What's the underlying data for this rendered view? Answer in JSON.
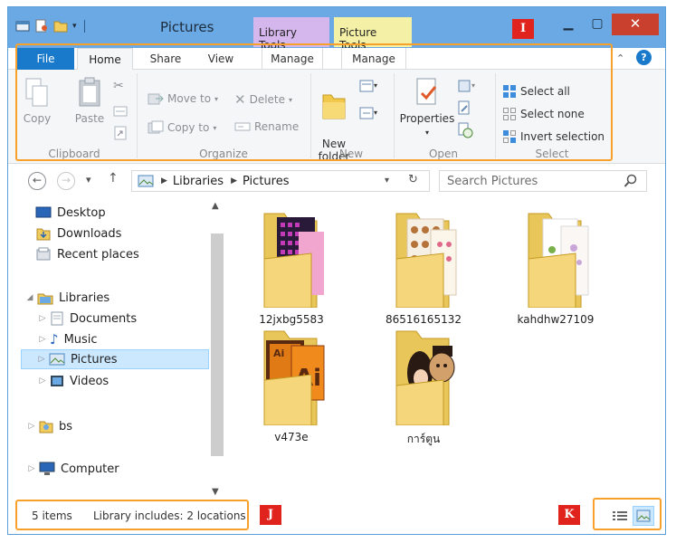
{
  "window": {
    "title": "Pictures"
  },
  "contextual_tabs": {
    "library_tools": "Library Tools",
    "picture_tools": "Picture Tools"
  },
  "ribbon_tabs": {
    "file": "File",
    "home": "Home",
    "share": "Share",
    "view": "View",
    "manage_library": "Manage",
    "manage_picture": "Manage"
  },
  "ribbon": {
    "clipboard": {
      "label": "Clipboard",
      "copy": "Copy",
      "paste": "Paste"
    },
    "organize": {
      "label": "Organize",
      "move_to": "Move to",
      "copy_to": "Copy to",
      "delete": "Delete",
      "rename": "Rename"
    },
    "new": {
      "label": "New",
      "new_folder": "New\nfolder"
    },
    "open": {
      "label": "Open",
      "properties": "Properties"
    },
    "select": {
      "label": "Select",
      "select_all": "Select all",
      "select_none": "Select none",
      "invert_selection": "Invert selection"
    }
  },
  "address": {
    "seg1": "Libraries",
    "seg2": "Pictures"
  },
  "search": {
    "placeholder": "Search Pictures"
  },
  "nav": {
    "desktop": "Desktop",
    "downloads": "Downloads",
    "recent": "Recent places",
    "libraries": "Libraries",
    "documents": "Documents",
    "music": "Music",
    "pictures": "Pictures",
    "videos": "Videos",
    "bs": "bs",
    "computer": "Computer"
  },
  "files": [
    {
      "name": "12jxbg5583"
    },
    {
      "name": "86516165132"
    },
    {
      "name": "kahdhw27109"
    },
    {
      "name": "v473e"
    },
    {
      "name": "การ์ตูน"
    }
  ],
  "status": {
    "items": "5 items",
    "library": "Library includes: 2 locations"
  },
  "annotations": {
    "ribbon": "I",
    "status": "J",
    "view": "K"
  },
  "colors": {
    "accent": "#1979ca",
    "annotation": "#f7a02a",
    "marker": "#e0231c",
    "close": "#c9402e",
    "titlebar": "#6aa9e4"
  }
}
